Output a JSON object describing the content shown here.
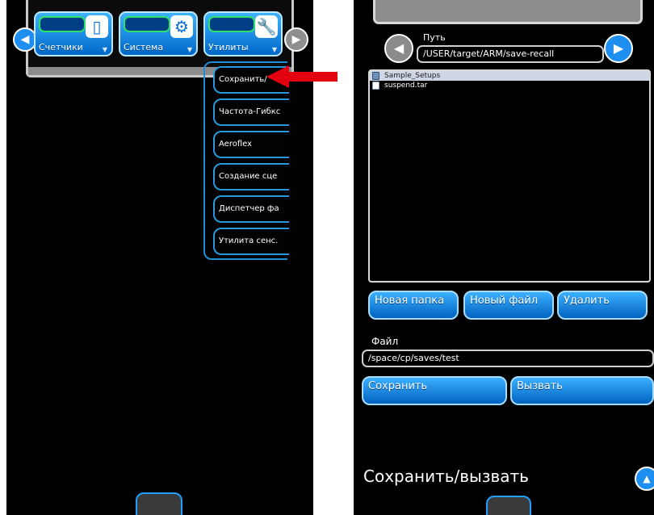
{
  "left": {
    "tabs": [
      {
        "label": "Счетчики",
        "icon": "counter-icon",
        "glyph": "▯"
      },
      {
        "label": "Система",
        "icon": "gear-icon",
        "glyph": "⚙"
      },
      {
        "label": "Утилиты",
        "icon": "wrench-icon",
        "glyph": "🔧"
      }
    ],
    "caret": "▼",
    "nav_prev": "◀",
    "nav_next": "▶",
    "dropdown": [
      "Сохранить/",
      "Частота-Гибкс",
      "Aeroflex",
      "Создание сце",
      "Диспетчер фа",
      "Утилита сенс."
    ]
  },
  "right": {
    "path_label": "Путь",
    "path_value": "/USER/target/ARM/save-recall",
    "path_prev": "◀",
    "path_next": "▶",
    "files": [
      {
        "name": "Sample_Setups",
        "type": "folder",
        "selected": true
      },
      {
        "name": "suspend.tar",
        "type": "file",
        "selected": false
      }
    ],
    "buttons": {
      "new_folder": "Новая папка",
      "new_file": "Новый файл",
      "delete": "Удалить"
    },
    "file_label": "Файл",
    "file_value": "/space/cp/saves/test",
    "save": "Сохранить",
    "recall": "Вызвать",
    "title": "Сохранить/вызвать",
    "collapse": "▲"
  },
  "colors": {
    "accent_blue": "#1e8ef0",
    "highlight_green": "#2ce36a",
    "arrow_red": "#e3000f"
  }
}
